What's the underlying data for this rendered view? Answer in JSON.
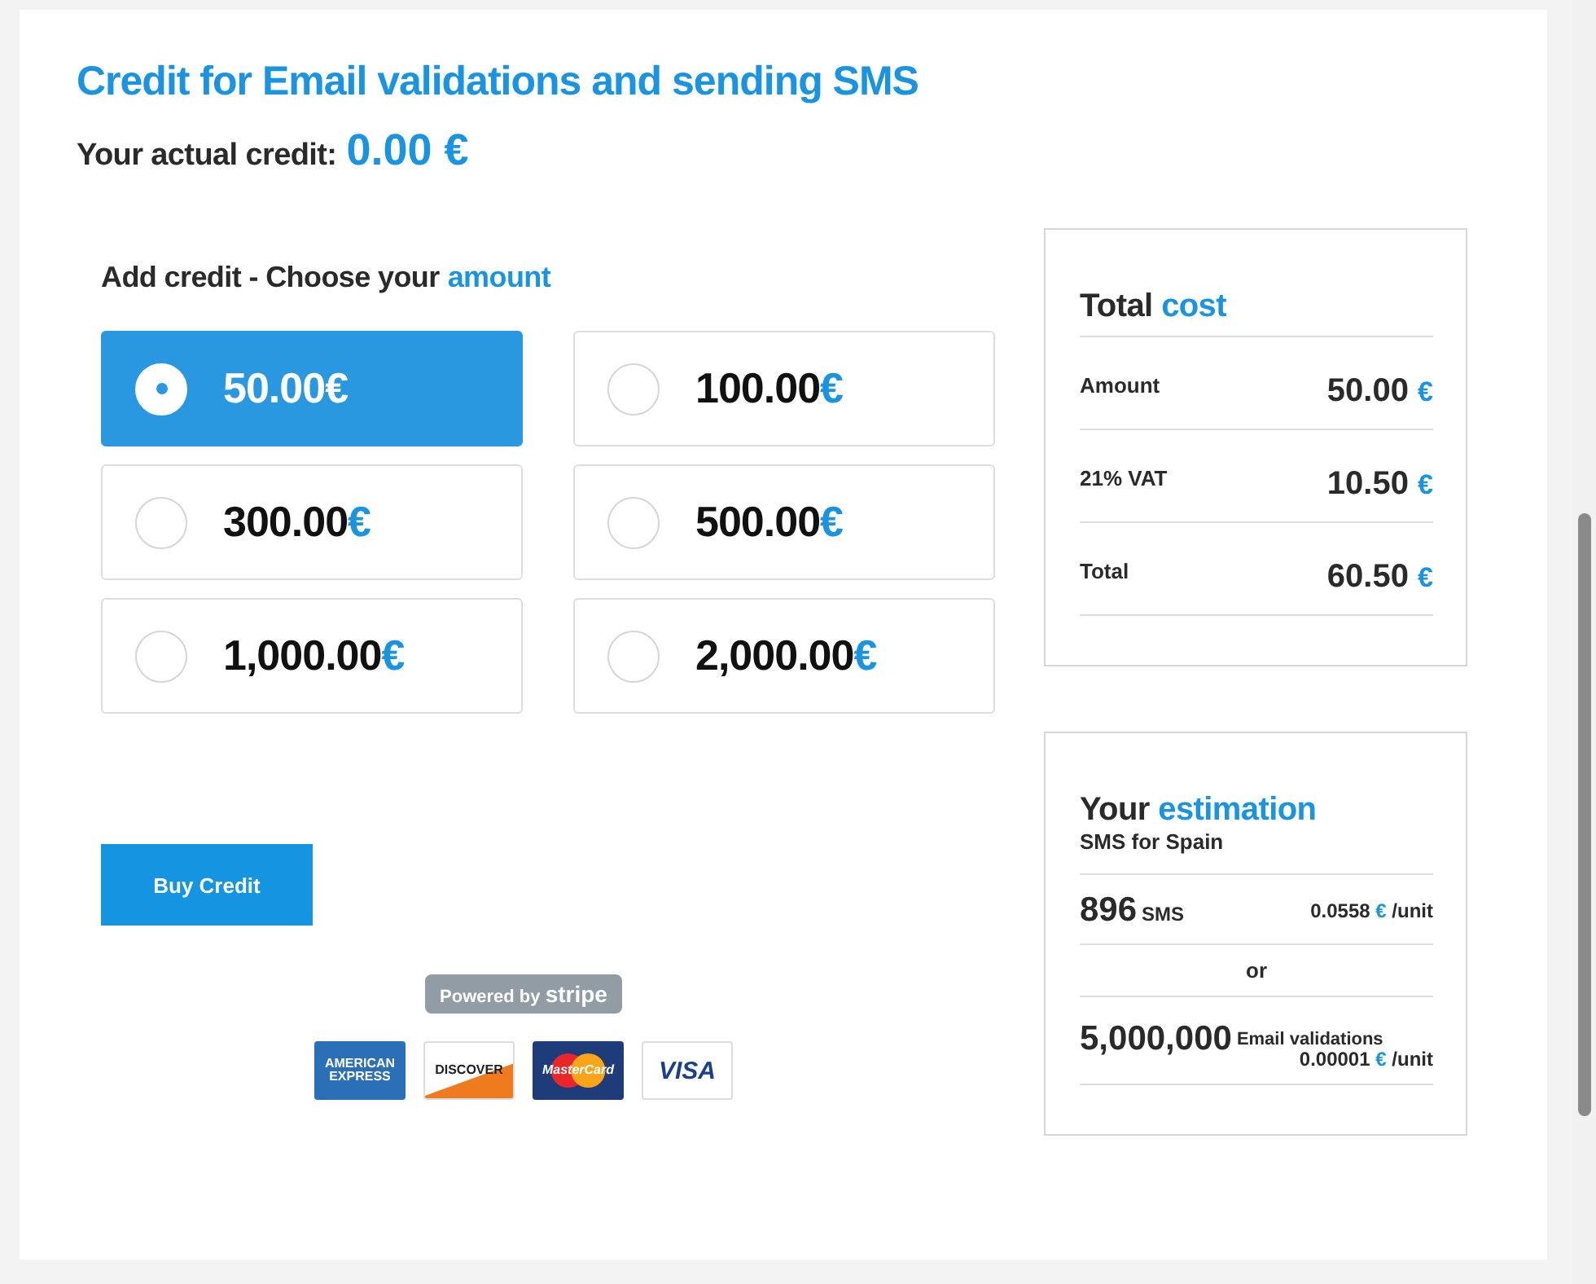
{
  "title": "Credit for Email validations and sending SMS",
  "credit": {
    "label": "Your actual credit:",
    "value": "0.00 €"
  },
  "add_credit": {
    "heading": "Add credit - Choose your",
    "accent": "amount"
  },
  "options": [
    {
      "amount": "50.00",
      "currency": "€",
      "selected": true
    },
    {
      "amount": "100.00",
      "currency": "€",
      "selected": false
    },
    {
      "amount": "300.00",
      "currency": "€",
      "selected": false
    },
    {
      "amount": "500.00",
      "currency": "€",
      "selected": false
    },
    {
      "amount": "1,000.00",
      "currency": "€",
      "selected": false
    },
    {
      "amount": "2,000.00",
      "currency": "€",
      "selected": false
    }
  ],
  "buy_button": "Buy Credit",
  "powered_by": {
    "text": "Powered by",
    "brand": "stripe"
  },
  "cards": [
    {
      "kind": "amex",
      "lines": [
        "AMERICAN",
        "EXPRESS"
      ]
    },
    {
      "kind": "discover",
      "lines": [
        "DISCOVER"
      ]
    },
    {
      "kind": "mastercard",
      "lines": [
        "MasterCard"
      ]
    },
    {
      "kind": "visa",
      "lines": [
        "VISA"
      ]
    }
  ],
  "total_cost": {
    "title": "Total",
    "accent": "cost",
    "rows": [
      {
        "label": "Amount",
        "value": "50.00",
        "currency": "€"
      },
      {
        "label": "21% VAT",
        "value": "10.50",
        "currency": "€"
      },
      {
        "label": "Total",
        "value": "60.50",
        "currency": "€"
      }
    ]
  },
  "estimation": {
    "title": "Your",
    "accent": "estimation",
    "subtitle": "SMS for Spain",
    "sms": {
      "count": "896",
      "unit": "SMS",
      "price": "0.0558",
      "currency": "€",
      "per": "/unit"
    },
    "or": "or",
    "email": {
      "count": "5,000,000",
      "unit": "Email validations",
      "price": "0.00001",
      "currency": "€",
      "per": "/unit"
    }
  }
}
